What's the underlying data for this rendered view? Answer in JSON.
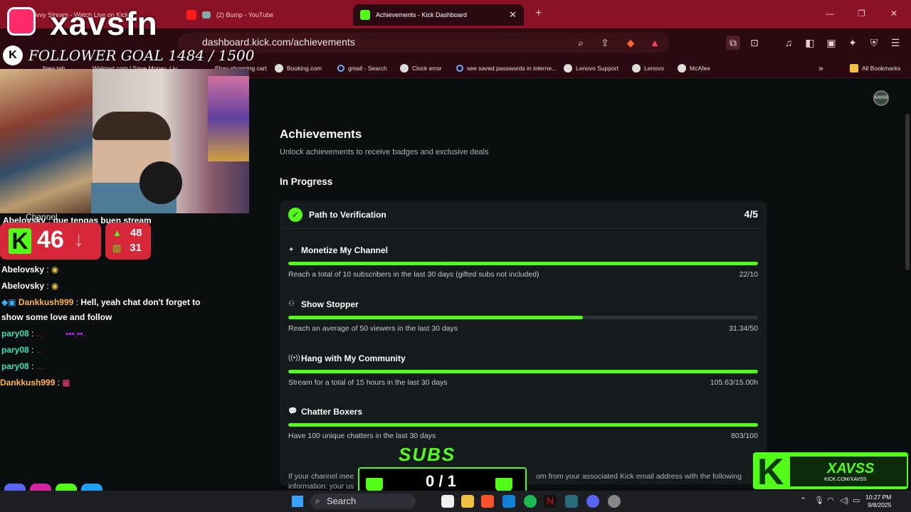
{
  "browser": {
    "tabs": [
      {
        "label": "Kovvy Stream - Watch Live on Kick"
      },
      {
        "label": "(2) Bump - YouTube"
      },
      {
        "label": "Achievements - Kick Dashboard",
        "active": true
      }
    ],
    "new_tab": "+",
    "url": "dashboard.kick.com/achievements",
    "bookmarks": [
      {
        "label": "New tab"
      },
      {
        "label": "Walmart.com | Save Money. Liv..."
      },
      {
        "label": "Ebay shopping cart"
      },
      {
        "label": "Booking.com"
      },
      {
        "label": "gmail - Search"
      },
      {
        "label": "Clock error"
      },
      {
        "label": "see saved passwords in interne..."
      },
      {
        "label": "Lenovo Support"
      },
      {
        "label": "Lenovo"
      },
      {
        "label": "McAfee"
      }
    ],
    "all_bookmarks": "All Bookmarks",
    "more": "»"
  },
  "page": {
    "title": "Achievements",
    "subtitle": "Unlock achievements to receive badges and exclusive deals",
    "section": "In Progress",
    "avatar_text": "XAVSS",
    "card": {
      "title": "Path to Verification",
      "count": "4/5",
      "tasks": [
        {
          "name": "Monetize My Channel",
          "desc": "Reach a total of 10 subscribers in the last 30 days (gifted subs not included)",
          "value": "22/10",
          "progress": 1.0
        },
        {
          "name": "Show Stopper",
          "desc": "Reach an average of 50 viewers in the last 30 days",
          "value": "31.34/50",
          "progress": 0.6268
        },
        {
          "name": "Hang with My Community",
          "desc": "Stream for a total of 15 hours in the last 30 days",
          "value": "105.63/15.00h",
          "progress": 1.0
        },
        {
          "name": "Chatter Boxers",
          "desc": "Have 100 unique chatters in the last 30 days",
          "value": "803/100",
          "progress": 1.0
        }
      ]
    },
    "footnote_left": "If your channel mee",
    "footnote_right": "om from your associated Kick email address with the following",
    "footnote_line2": "information: your us"
  },
  "overlay": {
    "streamer_name": "xavsfn",
    "follower_goal": "FOLLOWER GOAL 1484 / 1500",
    "channel_label": "Channel",
    "chat_overlap_text": "Abelovsky : que tengas buen stream",
    "viewer_count": "46",
    "viewer_trend": "↓",
    "stat_up": "48",
    "stat_bars": "31",
    "chat": [
      {
        "user": "Abelovsky",
        "color": "#ffffff",
        "text": ""
      },
      {
        "user": "Abelovsky",
        "color": "#ffffff",
        "text": ""
      },
      {
        "user": "Dankkush999",
        "color": "#ffb347",
        "text": "Hell, yeah chat don't forget to"
      },
      {
        "user": "",
        "color": "#ffffff",
        "text": "show some love and follow"
      },
      {
        "user": "pary08",
        "color": "#40e0b0",
        "text": ""
      },
      {
        "user": "pary08",
        "color": "#40e0b0",
        "text": ""
      },
      {
        "user": "pary08",
        "color": "#40e0b0",
        "text": ""
      },
      {
        "user": "Dankkush999",
        "color": "#ffb347",
        "text": ""
      }
    ],
    "counter_label": "SUBS",
    "counter_value": "0 / 1",
    "brand_name": "XAVSS",
    "brand_url": "KICK.COM/XAVSS"
  },
  "taskbar": {
    "search_label": "Search",
    "time": "10:27 PM",
    "date": "9/8/2025"
  }
}
